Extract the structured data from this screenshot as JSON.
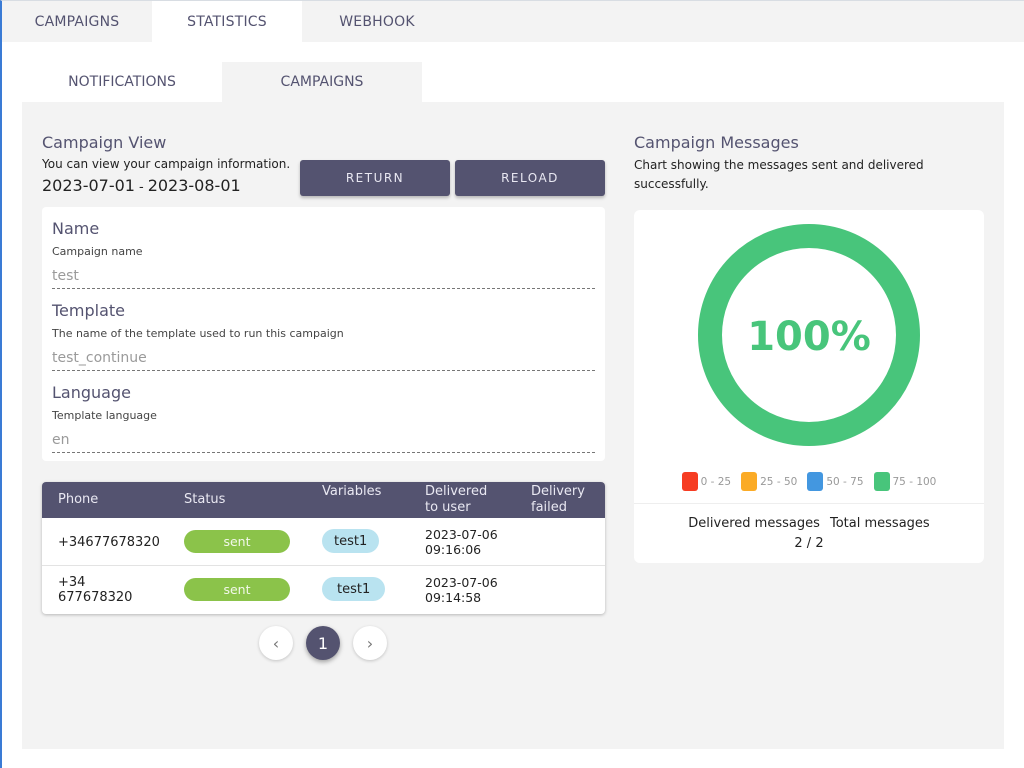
{
  "top_tabs": [
    {
      "label": "CAMPAIGNS",
      "active": false
    },
    {
      "label": "STATISTICS",
      "active": true
    },
    {
      "label": "WEBHOOK",
      "active": false
    }
  ],
  "sub_tabs": [
    {
      "label": "NOTIFICATIONS",
      "active": false
    },
    {
      "label": "CAMPAIGNS",
      "active": true
    }
  ],
  "campaign_view": {
    "title": "Campaign View",
    "subtitle": "You can view your campaign information.",
    "date_from": "2023-07-01",
    "date_separator": "-",
    "date_to": "2023-08-01",
    "return_label": "RETURN",
    "reload_label": "RELOAD"
  },
  "fields": [
    {
      "label": "Name",
      "help": "Campaign name",
      "value": "test"
    },
    {
      "label": "Template",
      "help": "The name of the template used to run this campaign",
      "value": "test_continue"
    },
    {
      "label": "Language",
      "help": "Template language",
      "value": "en"
    }
  ],
  "table": {
    "headers": {
      "phone": "Phone",
      "status": "Status",
      "variables": "Variables",
      "delivered_1": "Delivered",
      "delivered_2": "to user",
      "failed_1": "Delivery",
      "failed_2": "failed"
    },
    "rows": [
      {
        "phone_1": "+34677678320",
        "phone_2": "",
        "status": "sent",
        "variables": "test1",
        "delivered_date": "2023-07-06",
        "delivered_time": "09:16:06",
        "failed": ""
      },
      {
        "phone_1": "+34",
        "phone_2": "677678320",
        "status": "sent",
        "variables": "test1",
        "delivered_date": "2023-07-06",
        "delivered_time": "09:14:58",
        "failed": ""
      }
    ]
  },
  "pagination": {
    "prev_icon": "‹",
    "current_page": "1",
    "next_icon": "›"
  },
  "chart_panel": {
    "title": "Campaign Messages",
    "subtitle": "Chart showing the messages sent and delivered successfully.",
    "delivered_label": "Delivered messages",
    "total_label": "Total messages",
    "delivered_value": "2",
    "value_separator": "/",
    "total_value": "2"
  },
  "colors": {
    "primary": "#545370",
    "sent": "#8bc34a",
    "variable": "#b9e3f0"
  },
  "chart_data": {
    "type": "pie",
    "title": "Campaign Messages",
    "center_label": "100%",
    "value_percent": 100,
    "delivered": 2,
    "total": 2,
    "ring_color": "#48c57b",
    "legend_position": "bottom",
    "legend": [
      {
        "label": "0 - 25",
        "color": "#f63c22"
      },
      {
        "label": "25 - 50",
        "color": "#fbab26"
      },
      {
        "label": "50 - 75",
        "color": "#4397e0"
      },
      {
        "label": "75 - 100",
        "color": "#48c57b"
      }
    ]
  }
}
